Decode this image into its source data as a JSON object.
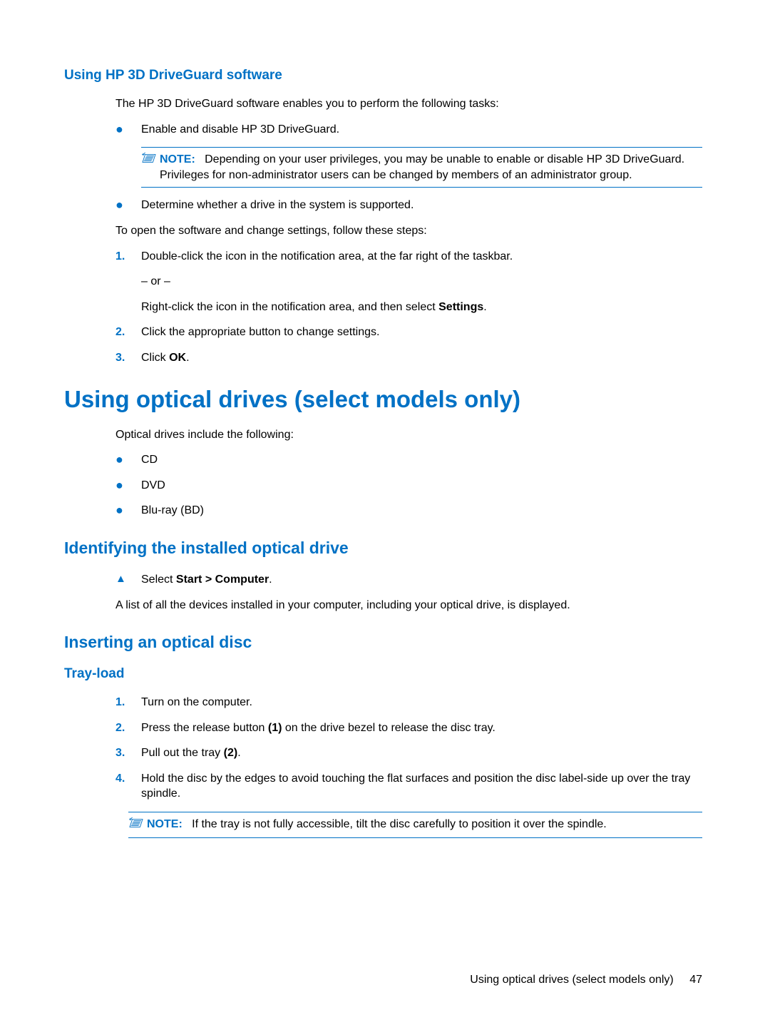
{
  "h3_driveguard": "Using HP 3D DriveGuard software",
  "p_intro": "The HP 3D DriveGuard software enables you to perform the following tasks:",
  "li_enable": "Enable and disable HP 3D DriveGuard.",
  "note1_label": "NOTE:",
  "note1_text": "Depending on your user privileges, you may be unable to enable or disable HP 3D DriveGuard. Privileges for non-administrator users can be changed by members of an administrator group.",
  "li_determine": "Determine whether a drive in the system is supported.",
  "p_open": "To open the software and change settings, follow these steps:",
  "step1_num": "1.",
  "step1_text": "Double-click the icon in the notification area, at the far right of the taskbar.",
  "step1_or": "– or –",
  "step1_alt_pre": "Right-click the icon in the notification area, and then select ",
  "step1_alt_bold": "Settings",
  "step1_alt_post": ".",
  "step2_num": "2.",
  "step2_text": "Click the appropriate button to change settings.",
  "step3_num": "3.",
  "step3_pre": "Click ",
  "step3_bold": "OK",
  "step3_post": ".",
  "h1_optical": "Using optical drives (select models only)",
  "p_optical_intro": "Optical drives include the following:",
  "li_cd": "CD",
  "li_dvd": "DVD",
  "li_bluray": "Blu-ray (BD)",
  "h2_identify": "Identifying the installed optical drive",
  "tri_select_pre": "Select ",
  "tri_select_bold": "Start > Computer",
  "tri_select_post": ".",
  "p_list_devices": "A list of all the devices installed in your computer, including your optical drive, is displayed.",
  "h2_insert": "Inserting an optical disc",
  "h3_tray": "Tray-load",
  "t_step1_num": "1.",
  "t_step1_text": "Turn on the computer.",
  "t_step2_num": "2.",
  "t_step2_pre": "Press the release button ",
  "t_step2_bold": "(1)",
  "t_step2_post": " on the drive bezel to release the disc tray.",
  "t_step3_num": "3.",
  "t_step3_pre": "Pull out the tray ",
  "t_step3_bold": "(2)",
  "t_step3_post": ".",
  "t_step4_num": "4.",
  "t_step4_text": "Hold the disc by the edges to avoid touching the flat surfaces and position the disc label-side up over the tray spindle.",
  "note2_label": "NOTE:",
  "note2_text": "If the tray is not fully accessible, tilt the disc carefully to position it over the spindle.",
  "footer_text": "Using optical drives (select models only)",
  "page_num": "47"
}
